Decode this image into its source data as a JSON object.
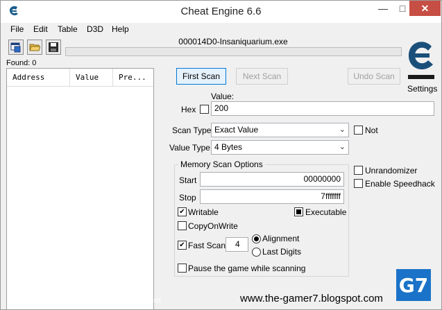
{
  "window": {
    "title": "Cheat Engine 6.6",
    "minimize": "—",
    "maximize": "□",
    "close": "✕"
  },
  "menu": [
    "File",
    "Edit",
    "Table",
    "D3D",
    "Help"
  ],
  "toolbar": {
    "process_name": "000014D0-Insaniquarium.exe",
    "icons": [
      "open-process-icon",
      "open-folder-icon",
      "save-icon"
    ],
    "progress": 0
  },
  "found": "Found: 0",
  "address_list": {
    "columns": [
      "Address",
      "Value",
      "Pre..."
    ]
  },
  "scan_buttons": {
    "first_scan": "First Scan",
    "next_scan": "Next Scan",
    "undo_scan": "Undo Scan"
  },
  "settings_label": "Settings",
  "value_section": {
    "value_label": "Value:",
    "hex_label": "Hex",
    "value": "200"
  },
  "scan_type": {
    "label": "Scan Type",
    "selected": "Exact Value",
    "not_label": "Not"
  },
  "value_type": {
    "label": "Value Type",
    "selected": "4 Bytes"
  },
  "memory_options": {
    "title": "Memory Scan Options",
    "start_label": "Start",
    "start_value": "00000000",
    "stop_label": "Stop",
    "stop_value": "7fffffff",
    "writable": "Writable",
    "executable": "Executable",
    "copy_on_write": "CopyOnWrite",
    "fast_scan": "Fast Scan",
    "fast_scan_value": "4",
    "alignment": "Alignment",
    "last_digits": "Last Digits",
    "pause": "Pause the game while scanning"
  },
  "side_options": {
    "unrandomizer": "Unrandomizer",
    "speedhack": "Enable Speedhack"
  },
  "watermark": {
    "left": "www.the-gamer7.blogspot.com",
    "right": "www.the-gamer7.blogspot.com",
    "logo": "G7"
  },
  "colors": {
    "accent": "#0078d7",
    "close": "#c74e44",
    "logo_blue": "#1a73c8"
  }
}
